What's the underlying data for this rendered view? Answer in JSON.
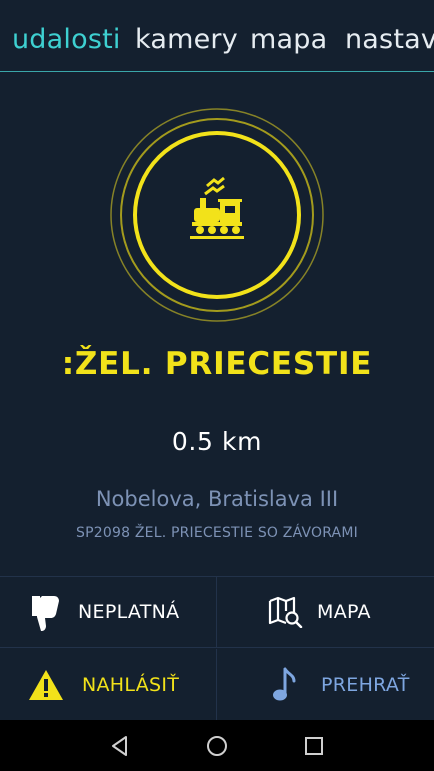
{
  "tabs": [
    {
      "label": "udalosti",
      "active": true
    },
    {
      "label": "kamery",
      "active": false
    },
    {
      "label": "mapa",
      "active": false
    },
    {
      "label": "nastav",
      "active": false
    }
  ],
  "event": {
    "icon": "train-crossing-icon",
    "title": ":ŽEL. PRIECESTIE",
    "distance": "0.5 km",
    "address": "Nobelova, Bratislava III",
    "description": "SP2098 ŽEL. PRIECESTIE SO ZÁVORAMI"
  },
  "actions": {
    "invalid": {
      "label": "NEPLATNÁ",
      "icon": "thumbs-down-icon"
    },
    "map": {
      "label": "MAPA",
      "icon": "map-search-icon"
    },
    "report": {
      "label": "NAHLÁSIŤ",
      "icon": "warning-icon"
    },
    "play": {
      "label": "PREHRAŤ",
      "icon": "music-note-icon"
    }
  },
  "navbar": {
    "back": "back-icon",
    "home": "home-icon",
    "recents": "recents-icon"
  },
  "colors": {
    "background": "#14202f",
    "accent": "#3ed0d1",
    "yellow": "#f2e21a",
    "muted": "#7d92b5"
  }
}
